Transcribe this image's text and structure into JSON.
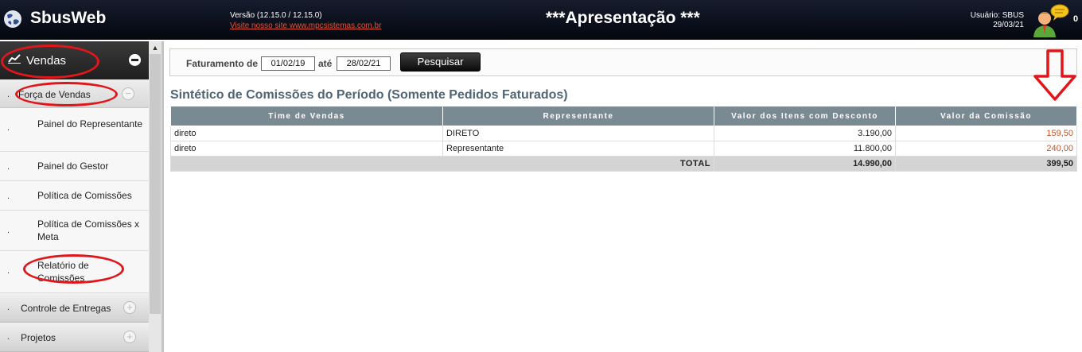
{
  "header": {
    "app_title": "SbusWeb",
    "version": "Versão (12.15.0 / 12.15.0)",
    "site_link": "Visite nosso site www.mpcsistemas.com.br",
    "presentation": "***Apresentação ***",
    "user_label": "Usuário: SBUS",
    "date": "29/03/21",
    "notification_count": "0",
    "logo_icon": "globe-icon",
    "avatar_icon": "user-chat-icon"
  },
  "sidebar": {
    "vendas": {
      "label": "Vendas",
      "icon": "chart-line-icon"
    },
    "forca_vendas": {
      "label": "Força de Vendas"
    },
    "items": [
      {
        "label": "Painel do Representante"
      },
      {
        "label": "Painel do Gestor"
      },
      {
        "label": "Política de Comissões"
      },
      {
        "label": "Política de Comissões x Meta"
      },
      {
        "label": "Relatório de Comissões"
      }
    ],
    "sections": [
      {
        "label": "Controle de Entregas"
      },
      {
        "label": "Projetos"
      }
    ]
  },
  "filter": {
    "label_from": "Faturamento de",
    "date_from": "01/02/19",
    "label_to": "até",
    "date_to": "28/02/21",
    "search_button": "Pesquisar"
  },
  "report": {
    "title": "Sintético de Comissões do Período (Somente Pedidos Faturados)",
    "columns": [
      "Time de Vendas",
      "Representante",
      "Valor dos Itens com Desconto",
      "Valor da Comissão"
    ],
    "rows": [
      [
        "direto",
        "DIRETO",
        "3.190,00",
        "159,50"
      ],
      [
        "direto",
        "Representante",
        "11.800,00",
        "240,00"
      ]
    ],
    "total_label": "TOTAL",
    "total_items": "14.990,00",
    "total_commission": "399,50"
  },
  "colors": {
    "header_bg": "#0b0f1b",
    "table_header_bg": "#7a8a93",
    "title_color": "#4f6574",
    "commission_color": "#c0562f",
    "annotation_red": "#e0161b"
  }
}
